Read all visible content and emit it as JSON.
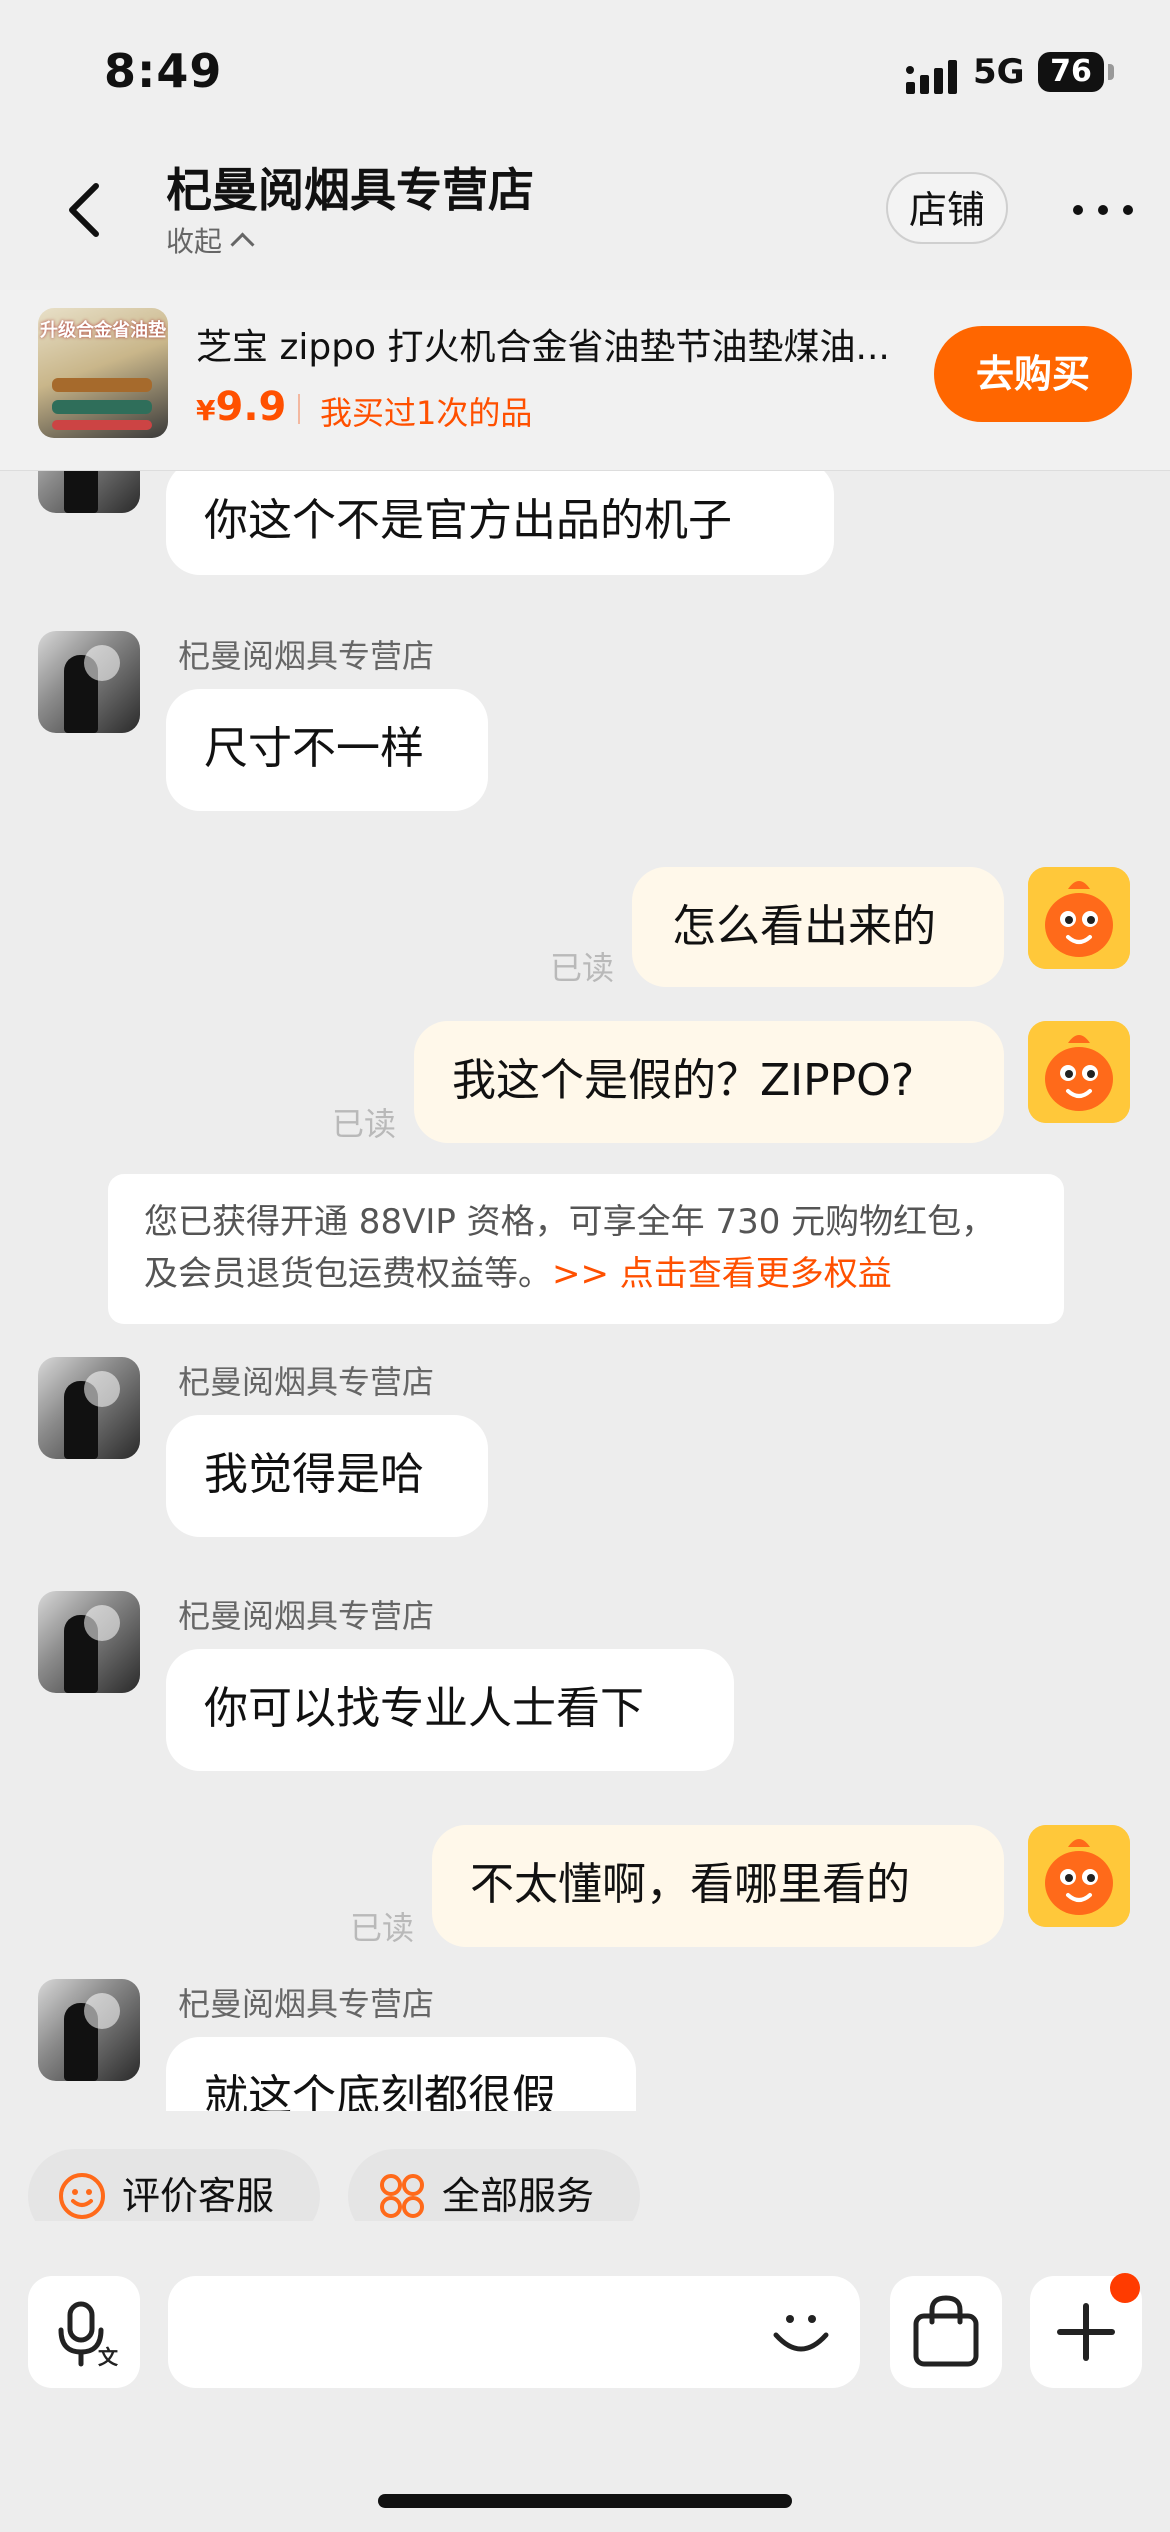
{
  "status_bar": {
    "time": "8:49",
    "network": "5G",
    "battery": "76"
  },
  "nav": {
    "store_name": "杞曼阅烟具专营店",
    "collapse_label": "收起",
    "shop_button": "店铺"
  },
  "product": {
    "thumb_tag": "升级合金省油垫",
    "name": "芝宝 zippo 打火机合金省油垫节油垫煤油...",
    "currency": "¥",
    "price": "9.9",
    "bought": "我买过1次的品",
    "buy_button": "去购买"
  },
  "chat": {
    "read_label": "已读",
    "messages": [
      {
        "side": "in",
        "sender": "",
        "text": "你这个不是官方出品的机子"
      },
      {
        "side": "in",
        "sender": "杞曼阅烟具专营店",
        "text": "尺寸不一样"
      },
      {
        "side": "out",
        "text": "怎么看出来的",
        "status": "已读"
      },
      {
        "side": "out",
        "text": "我这个是假的？ZIPPO?",
        "status": "已读"
      },
      {
        "side": "in",
        "sender": "杞曼阅烟具专营店",
        "text": "我觉得是哈"
      },
      {
        "side": "in",
        "sender": "杞曼阅烟具专营店",
        "text": "你可以找专业人士看下"
      },
      {
        "side": "out",
        "text": "不太懂啊，看哪里看的",
        "status": "已读"
      },
      {
        "side": "in",
        "sender": "杞曼阅烟具专营店",
        "text": "就这个底刻都很假"
      }
    ],
    "notice": {
      "text": "您已获得开通 88VIP 资格，可享全年 730 元购物红包，及会员退货包运费权益等。",
      "link": ">> 点击查看更多权益"
    }
  },
  "quick_actions": {
    "rate_service": "评价客服",
    "all_services": "全部服务"
  },
  "input": {
    "placeholder": ""
  },
  "colors": {
    "accent": "#ff5000",
    "buy_button": "#ff6600",
    "outgoing_bubble": "#fff8ea",
    "background": "#ededed"
  }
}
